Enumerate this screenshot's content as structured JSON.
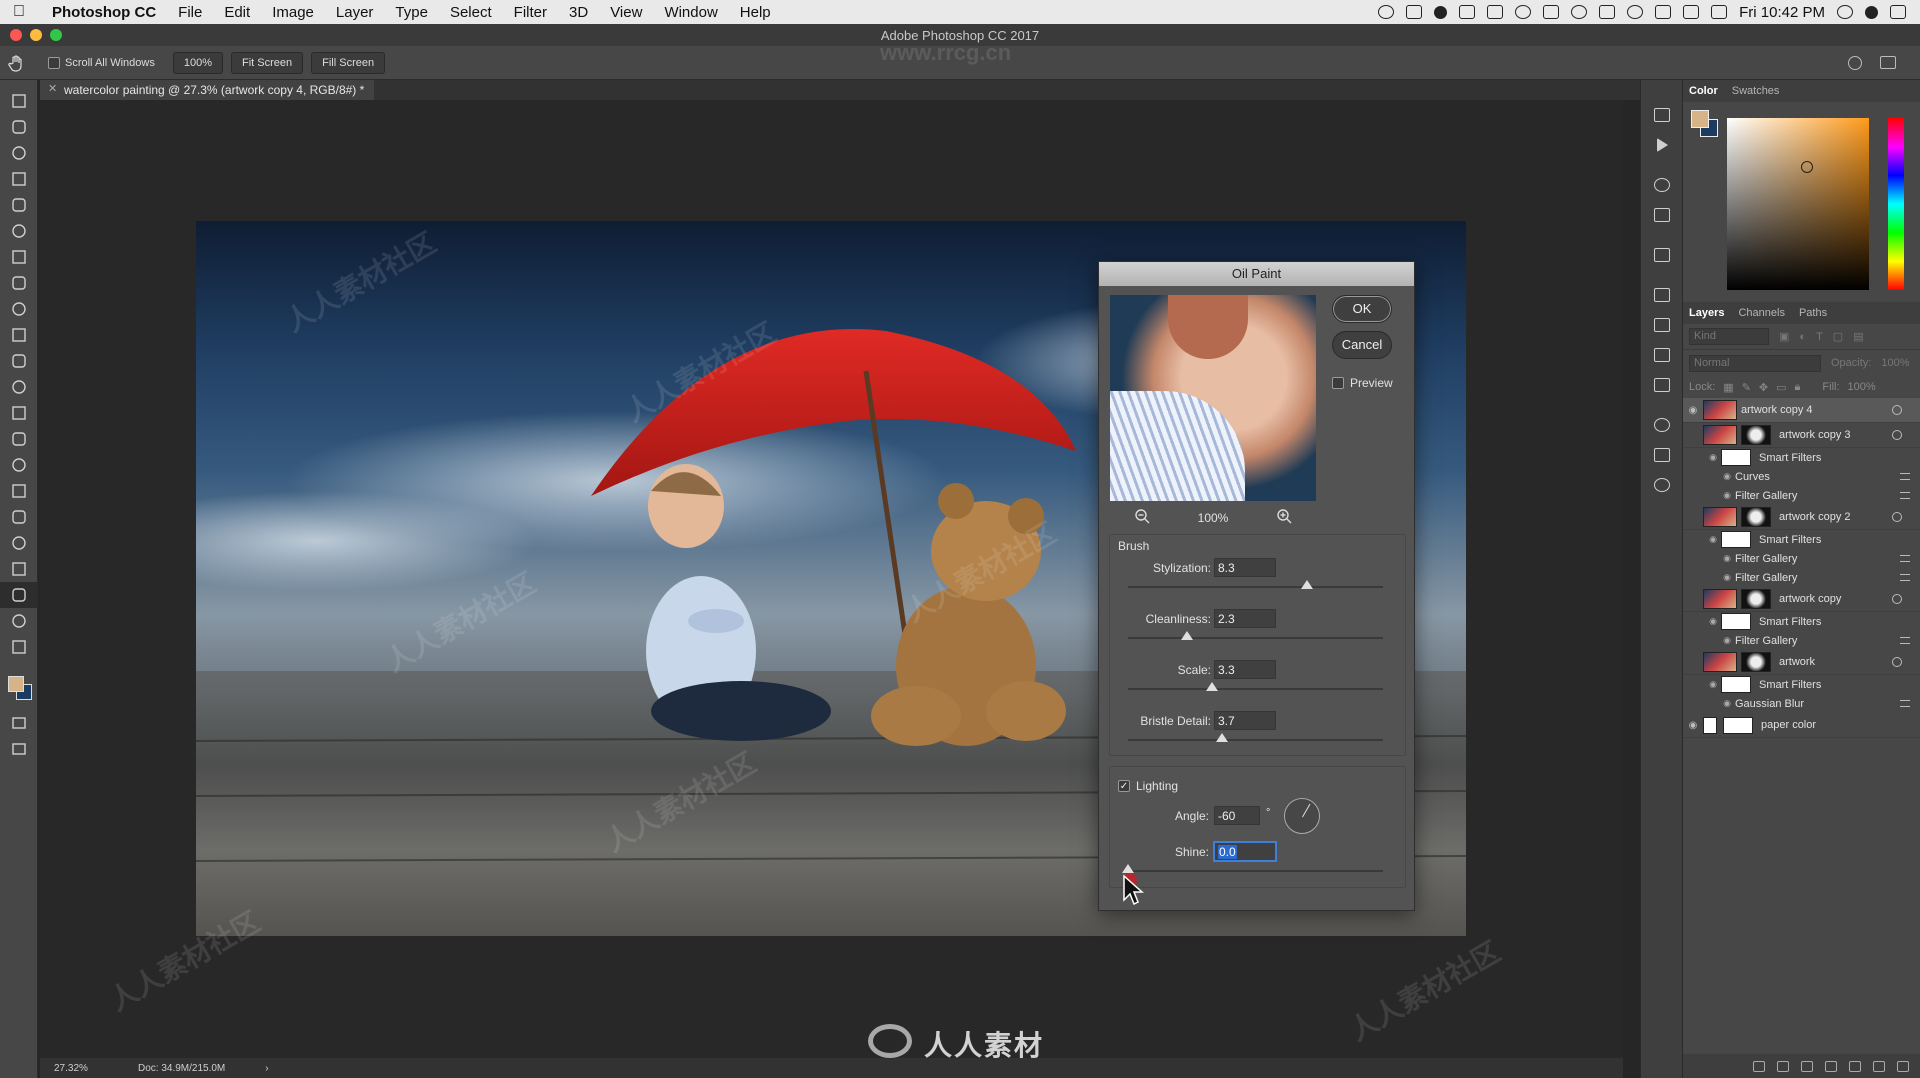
{
  "menubar": {
    "app_name": "Photoshop CC",
    "items": [
      "File",
      "Edit",
      "Image",
      "Layer",
      "Type",
      "Select",
      "Filter",
      "3D",
      "View",
      "Window",
      "Help"
    ],
    "clock": "Fri 10:42 PM"
  },
  "window": {
    "title": "Adobe Photoshop CC 2017"
  },
  "options_bar": {
    "scroll_all_windows": "Scroll All Windows",
    "zoom_btn": "100%",
    "fit_screen": "Fit Screen",
    "fill_screen": "Fill Screen"
  },
  "document": {
    "tab_title": "watercolor painting @ 27.3% (artwork copy 4, RGB/8#) *",
    "status_zoom": "27.32%",
    "status_doc": "Doc: 34.9M/215.0M"
  },
  "watermark": {
    "text": "人人素材社区",
    "brand": "人人素材",
    "url": "www.rrcg.cn"
  },
  "dialog": {
    "title": "Oil Paint",
    "ok": "OK",
    "cancel": "Cancel",
    "preview_label": "Preview",
    "preview_checked": false,
    "zoom": "100%",
    "brush_group": "Brush",
    "params": [
      {
        "label": "Stylization:",
        "value": "8.3",
        "fraction": 0.7
      },
      {
        "label": "Cleanliness:",
        "value": "2.3",
        "fraction": 0.23
      },
      {
        "label": "Scale:",
        "value": "3.3",
        "fraction": 0.33
      },
      {
        "label": "Bristle Detail:",
        "value": "3.7",
        "fraction": 0.37
      }
    ],
    "lighting_label": "Lighting",
    "lighting_checked": true,
    "angle_label": "Angle:",
    "angle_value": "-60",
    "angle_unit": "°",
    "angle_deg": -60,
    "shine_label": "Shine:",
    "shine_value": "0.0",
    "shine_fraction": 0.0
  },
  "panels": {
    "color_tab": "Color",
    "swatches_tab": "Swatches",
    "foreground_color": "#d7b488",
    "background_color": "#1b3c62",
    "layers_tab": "Layers",
    "channels_tab": "Channels",
    "paths_tab": "Paths",
    "kind_placeholder": "Kind",
    "blend_mode": "Normal",
    "opacity_label": "Opacity:",
    "opacity_value": "100%",
    "lock_label": "Lock:",
    "fill_label": "Fill:",
    "fill_value": "100%",
    "layers": [
      {
        "name": "artwork copy 4",
        "type": "layer",
        "visible": true,
        "selected": true
      },
      {
        "name": "artwork copy 3",
        "type": "smart",
        "visible": false
      },
      {
        "name": "Smart Filters",
        "type": "filters"
      },
      {
        "name": "Curves",
        "type": "filter"
      },
      {
        "name": "Filter Gallery",
        "type": "filter"
      },
      {
        "name": "artwork copy 2",
        "type": "smart",
        "visible": false
      },
      {
        "name": "Smart Filters",
        "type": "filters"
      },
      {
        "name": "Filter Gallery",
        "type": "filter"
      },
      {
        "name": "Filter Gallery",
        "type": "filter"
      },
      {
        "name": "artwork copy",
        "type": "smart",
        "visible": false
      },
      {
        "name": "Smart Filters",
        "type": "filters"
      },
      {
        "name": "Filter Gallery",
        "type": "filter"
      },
      {
        "name": "artwork",
        "type": "smart",
        "visible": false
      },
      {
        "name": "Smart Filters",
        "type": "filters"
      },
      {
        "name": "Gaussian Blur",
        "type": "filter"
      },
      {
        "name": "paper color",
        "type": "fill",
        "visible": true
      }
    ]
  }
}
